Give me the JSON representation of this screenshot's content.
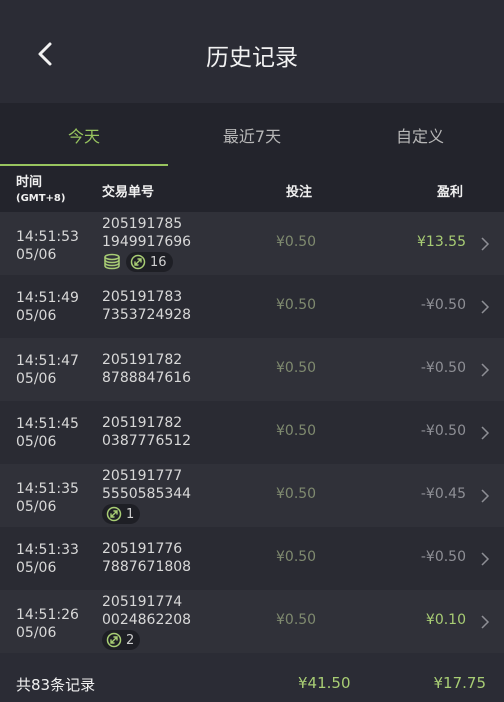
{
  "header": {
    "title": "历史记录"
  },
  "tabs": [
    {
      "label": "今天"
    },
    {
      "label": "最近7天"
    },
    {
      "label": "自定义"
    }
  ],
  "columns": {
    "time": "时间",
    "timezone": "(GMT+8)",
    "order": "交易单号",
    "bet": "投注",
    "profit": "盈利"
  },
  "rows": [
    {
      "time": "14:51:53",
      "date": "05/06",
      "order_line1": "205191785",
      "order_line2": "1949917696",
      "bet": "¥0.50",
      "profit": "¥13.55",
      "profit_color": "#a8cd74",
      "badge_count": "16",
      "has_coins": true
    },
    {
      "time": "14:51:49",
      "date": "05/06",
      "order_line1": "205191783",
      "order_line2": "7353724928",
      "bet": "¥0.50",
      "profit": "-¥0.50",
      "profit_color": "#8e8f95"
    },
    {
      "time": "14:51:47",
      "date": "05/06",
      "order_line1": "205191782",
      "order_line2": "8788847616",
      "bet": "¥0.50",
      "profit": "-¥0.50",
      "profit_color": "#8e8f95"
    },
    {
      "time": "14:51:45",
      "date": "05/06",
      "order_line1": "205191782",
      "order_line2": "0387776512",
      "bet": "¥0.50",
      "profit": "-¥0.50",
      "profit_color": "#8e8f95"
    },
    {
      "time": "14:51:35",
      "date": "05/06",
      "order_line1": "205191777",
      "order_line2": "5550585344",
      "bet": "¥0.50",
      "profit": "-¥0.45",
      "profit_color": "#8e8f95",
      "badge_count": "1"
    },
    {
      "time": "14:51:33",
      "date": "05/06",
      "order_line1": "205191776",
      "order_line2": "7887671808",
      "bet": "¥0.50",
      "profit": "-¥0.50",
      "profit_color": "#8e8f95"
    },
    {
      "time": "14:51:26",
      "date": "05/06",
      "order_line1": "205191774",
      "order_line2": "0024862208",
      "bet": "¥0.50",
      "profit": "¥0.10",
      "profit_color": "#a8cd74",
      "badge_count": "2"
    }
  ],
  "footer": {
    "total_label": "共83条记录",
    "total_bet": "¥41.50",
    "total_profit": "¥17.75"
  },
  "colors": {
    "accent": "#98c45f",
    "positive": "#a8cd74",
    "negative": "#8e8f95"
  }
}
